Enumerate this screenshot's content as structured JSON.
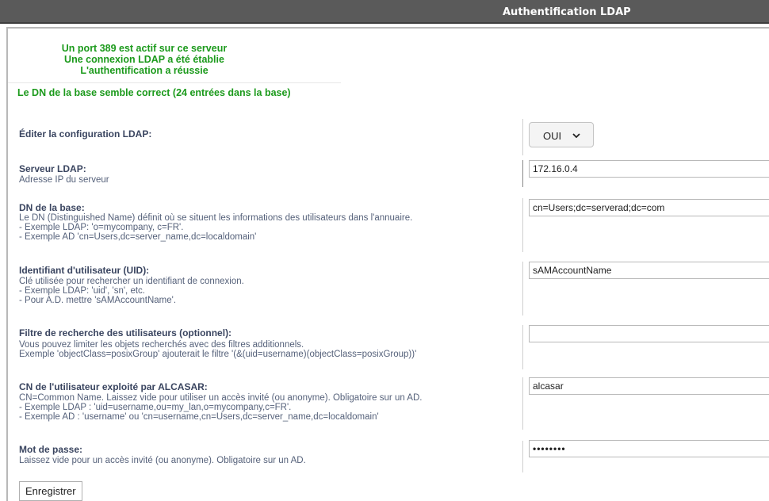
{
  "header": {
    "title": "Authentification LDAP"
  },
  "status": {
    "line1": "Un port 389 est actif sur ce serveur",
    "line2": "Une connexion LDAP a été établie",
    "line3": "L'authentification a réussie",
    "line4": "Le DN de la base semble correct (24 entrées dans la base)"
  },
  "edit_config": {
    "label": "Éditer la configuration LDAP:",
    "selected": "OUI"
  },
  "server": {
    "label": "Serveur LDAP:",
    "desc": "Adresse IP du serveur",
    "value": "172.16.0.4"
  },
  "base_dn": {
    "label": "DN de la base:",
    "desc1": "Le DN (Distinguished Name) définit où se situent les informations des utilisateurs dans l'annuaire.",
    "desc2": "- Exemple LDAP: 'o=mycompany, c=FR'.",
    "desc3": "- Exemple AD 'cn=Users,dc=server_name,dc=localdomain'",
    "value": "cn=Users;dc=serverad;dc=com"
  },
  "uid": {
    "label": "Identifiant d'utilisateur (UID):",
    "desc1": "Clé utilisée pour rechercher un identifiant de connexion.",
    "desc2": "- Exemple LDAP: 'uid', 'sn', etc.",
    "desc3": "- Pour A.D. mettre 'sAMAccountName'.",
    "value": "sAMAccountName"
  },
  "filter": {
    "label": "Filtre de recherche des utilisateurs (optionnel):",
    "desc1": "Vous pouvez limiter les objets recherchés avec des filtres additionnels.",
    "desc2": "Exemple 'objectClass=posixGroup' ajouterait le filtre '(&(uid=username)(objectClass=posixGroup))'",
    "value": ""
  },
  "bind_user": {
    "label": "CN de l'utilisateur exploité par ALCASAR:",
    "desc1": "CN=Common Name. Laissez vide pour utiliser un accès invité (ou anonyme). Obligatoire sur un AD.",
    "desc2": "- Exemple LDAP : 'uid=username,ou=my_lan,o=mycompany,c=FR'.",
    "desc3": "- Exemple AD : 'username' ou 'cn=username,cn=Users,dc=server_name,dc=localdomain'",
    "value": "alcasar"
  },
  "password": {
    "label": "Mot de passe:",
    "desc": "Laissez vide pour un accès invité (ou anonyme). Obligatoire sur un AD.",
    "value": "••••••••"
  },
  "actions": {
    "save_label": "Enregistrer"
  }
}
